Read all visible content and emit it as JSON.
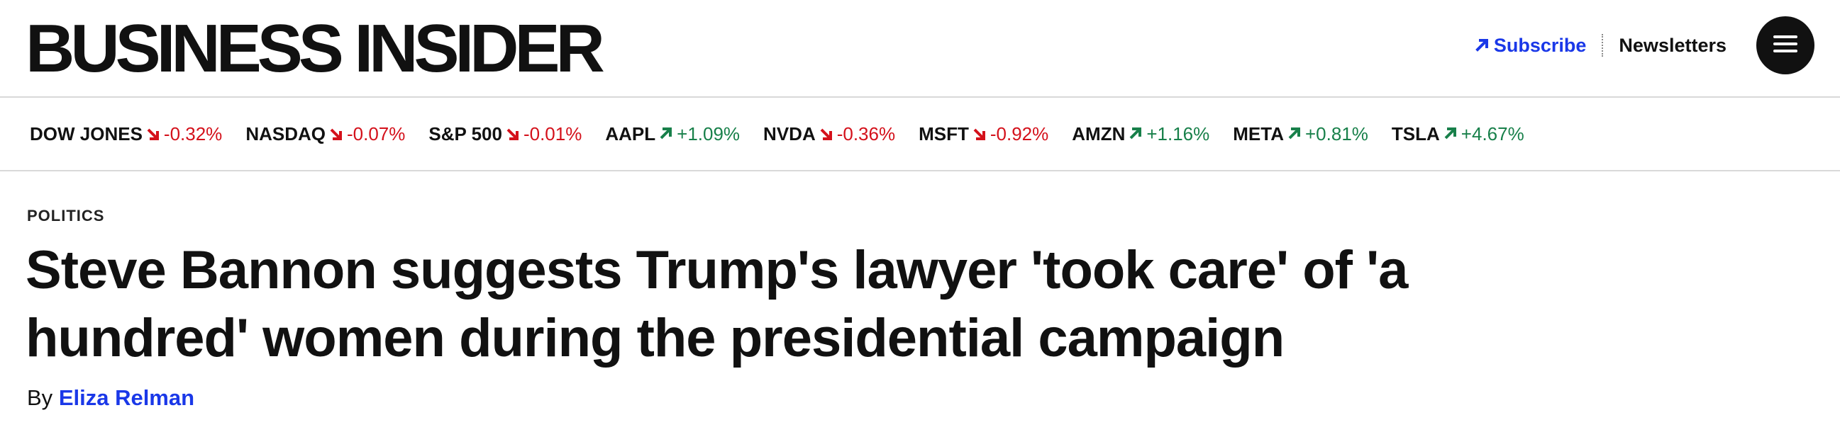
{
  "header": {
    "logo_text": "BUSINESS INSIDER",
    "subscribe_label": "Subscribe",
    "newsletters_label": "Newsletters",
    "menu_icon": "hamburger-menu-icon",
    "accent_color": "#1a38e8"
  },
  "ticker": {
    "down_color": "#d4111b",
    "up_color": "#18804a",
    "items": [
      {
        "symbol": "DOW JONES",
        "change": "-0.32%",
        "direction": "down"
      },
      {
        "symbol": "NASDAQ",
        "change": "-0.07%",
        "direction": "down"
      },
      {
        "symbol": "S&P 500",
        "change": "-0.01%",
        "direction": "down"
      },
      {
        "symbol": "AAPL",
        "change": "+1.09%",
        "direction": "up"
      },
      {
        "symbol": "NVDA",
        "change": "-0.36%",
        "direction": "down"
      },
      {
        "symbol": "MSFT",
        "change": "-0.92%",
        "direction": "down"
      },
      {
        "symbol": "AMZN",
        "change": "+1.16%",
        "direction": "up"
      },
      {
        "symbol": "META",
        "change": "+0.81%",
        "direction": "up"
      },
      {
        "symbol": "TSLA",
        "change": "+4.67%",
        "direction": "up"
      }
    ]
  },
  "article": {
    "category": "POLITICS",
    "headline_line1": "Steve Bannon suggests Trump's lawyer 'took care' of 'a",
    "headline_line2": "hundred' women during the presidential campaign",
    "byline_prefix": "By",
    "author": "Eliza Relman"
  }
}
